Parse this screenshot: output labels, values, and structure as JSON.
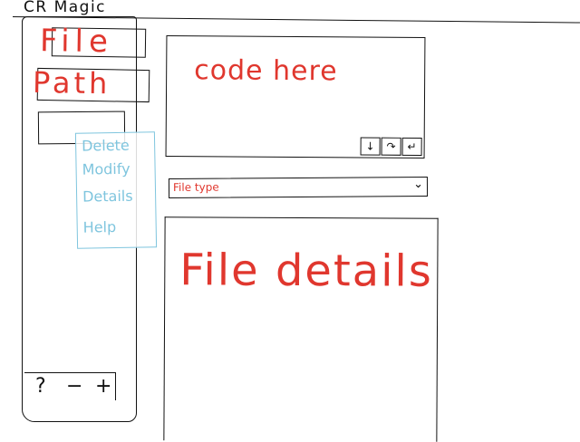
{
  "app": {
    "title": "CR Magic"
  },
  "sidebar": {
    "items": [
      {
        "label": "File"
      },
      {
        "label": "Path"
      },
      {
        "label": ""
      }
    ],
    "context_menu": {
      "items": [
        "Delete",
        "Modify",
        "Details",
        "Help"
      ]
    },
    "footer": {
      "help_label": "?",
      "remove_label": "−",
      "add_label": "+"
    }
  },
  "editor": {
    "placeholder": "code here",
    "toolbar": {
      "down_label": "↓",
      "redo_label": "↷",
      "enter_label": "↵"
    }
  },
  "file_type": {
    "value": "File type",
    "chevron": "⌄"
  },
  "details": {
    "placeholder": "File details"
  },
  "colors": {
    "sketch_ink": "#111111",
    "placeholder_red": "#e0372e",
    "menu_blue": "#7fc5de"
  }
}
